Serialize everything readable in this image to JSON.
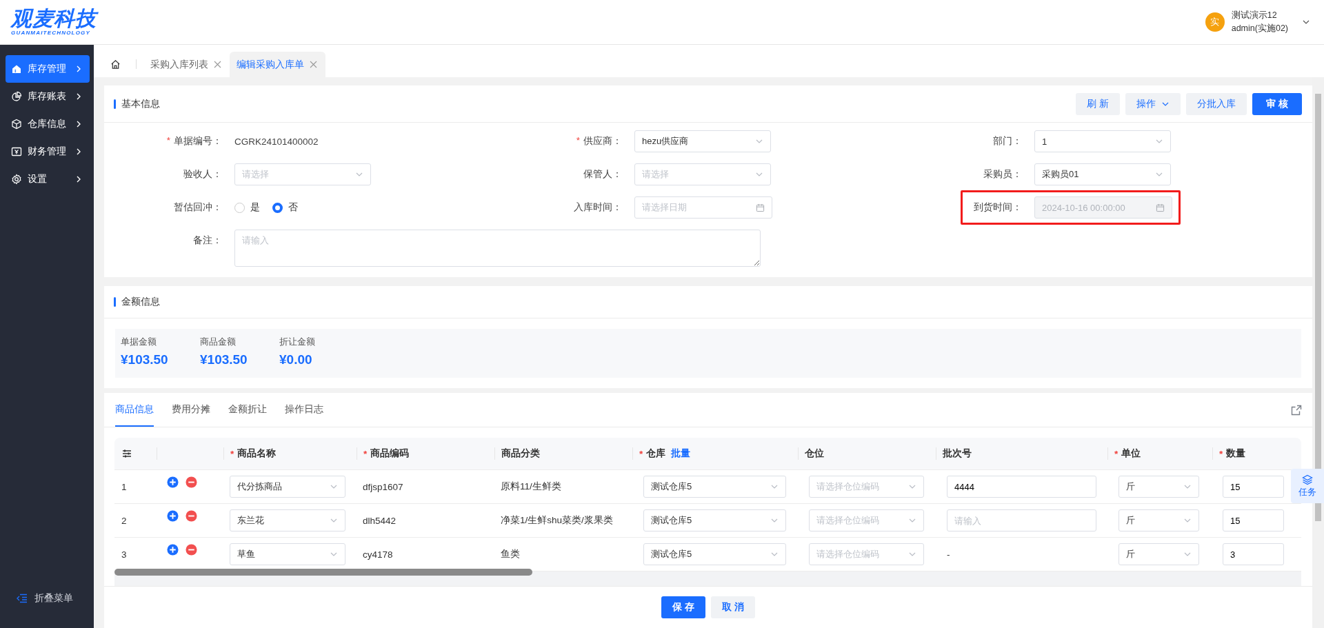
{
  "header": {
    "logo": "观麦科技",
    "logo_sub": "GUANMAITECHNOLOGY",
    "avatar": "实",
    "user_name": "测试演示12",
    "user_role": "admin(实施02)"
  },
  "sidebar": {
    "items": [
      {
        "label": "库存管理",
        "selected": true
      },
      {
        "label": "库存账表",
        "selected": false
      },
      {
        "label": "仓库信息",
        "selected": false
      },
      {
        "label": "财务管理",
        "selected": false
      },
      {
        "label": "设置",
        "selected": false
      }
    ],
    "collapse": "折叠菜单"
  },
  "page_tabs": [
    {
      "label": "采购入库列表",
      "selected": false
    },
    {
      "label": "编辑采购入库单",
      "selected": true
    }
  ],
  "basic_info": {
    "title": "基本信息",
    "actions": [
      {
        "label": "刷 新",
        "kind": "plain"
      },
      {
        "label": "操作",
        "kind": "dropdown"
      },
      {
        "label": "分批入库",
        "kind": "plain"
      },
      {
        "label": "审 核",
        "kind": "primary"
      }
    ],
    "fields": [
      {
        "label": "单据编号：",
        "required_mark": "*",
        "kind": "text",
        "value": "CGRK24101400002"
      },
      {
        "label": "供应商：",
        "required_mark": "*",
        "kind": "select",
        "value": "hezu供应商"
      },
      {
        "label": "部门：",
        "kind": "select",
        "value": "1"
      },
      {
        "label": "验收人：",
        "kind": "select",
        "placeholder": "请选择"
      },
      {
        "label": "保管人：",
        "kind": "select",
        "placeholder": "请选择"
      },
      {
        "label": "采购员：",
        "kind": "select",
        "value": "采购员01"
      },
      {
        "label": "暂估回冲：",
        "kind": "radio",
        "options": [
          {
            "label": "是",
            "selected": false
          },
          {
            "label": "否",
            "selected": true
          }
        ]
      },
      {
        "label": "入库时间：",
        "kind": "date",
        "placeholder": "请选择日期",
        "disabled": false
      },
      {
        "label": "到货时间：",
        "kind": "date",
        "value": "2024-10-16 00:00:00",
        "disabled": true,
        "highlighted": true
      },
      {
        "label": "备注：",
        "kind": "textarea",
        "placeholder": "请输入"
      }
    ]
  },
  "amount_info": {
    "title": "金额信息",
    "items": [
      {
        "label": "单据金额",
        "value": "¥103.50"
      },
      {
        "label": "商品金额",
        "value": "¥103.50"
      },
      {
        "label": "折让金额",
        "value": "¥0.00"
      }
    ]
  },
  "goods": {
    "tabs": [
      {
        "label": "商品信息",
        "selected": true
      },
      {
        "label": "费用分摊",
        "selected": false
      },
      {
        "label": "金额折让",
        "selected": false
      },
      {
        "label": "操作日志",
        "selected": false
      }
    ],
    "columns": [
      {
        "label": "商品名称",
        "required_mark": "*"
      },
      {
        "label": "商品编码",
        "required_mark": "*"
      },
      {
        "label": "商品分类"
      },
      {
        "label": "仓库",
        "required_mark": "*",
        "link": "批量"
      },
      {
        "label": "仓位"
      },
      {
        "label": "批次号"
      },
      {
        "label": "单位",
        "required_mark": "*"
      },
      {
        "label": "数量",
        "required_mark": "*"
      }
    ],
    "rows": [
      {
        "index": "1",
        "name": "代分拣商品",
        "code": "dfjsp1607",
        "category": "原料11/生鲜类",
        "warehouse": "测试仓库5",
        "bin_placeholder": "请选择仓位编码",
        "batch": {
          "kind": "input",
          "value": "4444"
        },
        "unit": "斤",
        "qty": "15"
      },
      {
        "index": "2",
        "name": "东兰花",
        "code": "dlh5442",
        "category": "净菜1/生鲜shu菜类/浆果类",
        "warehouse": "测试仓库5",
        "bin_placeholder": "请选择仓位编码",
        "batch": {
          "kind": "input",
          "placeholder": "请输入"
        },
        "unit": "斤",
        "qty": "15"
      },
      {
        "index": "3",
        "name": "草鱼",
        "code": "cy4178",
        "category": "鱼类",
        "warehouse": "测试仓库5",
        "bin_placeholder": "请选择仓位编码",
        "batch": {
          "kind": "text",
          "value": "-"
        },
        "unit": "斤",
        "qty": "3"
      }
    ]
  },
  "footer": {
    "buttons": [
      {
        "label": "保 存",
        "kind": "primary"
      },
      {
        "label": "取 消",
        "kind": "plain"
      }
    ]
  },
  "task_tab": {
    "label": "任务"
  }
}
